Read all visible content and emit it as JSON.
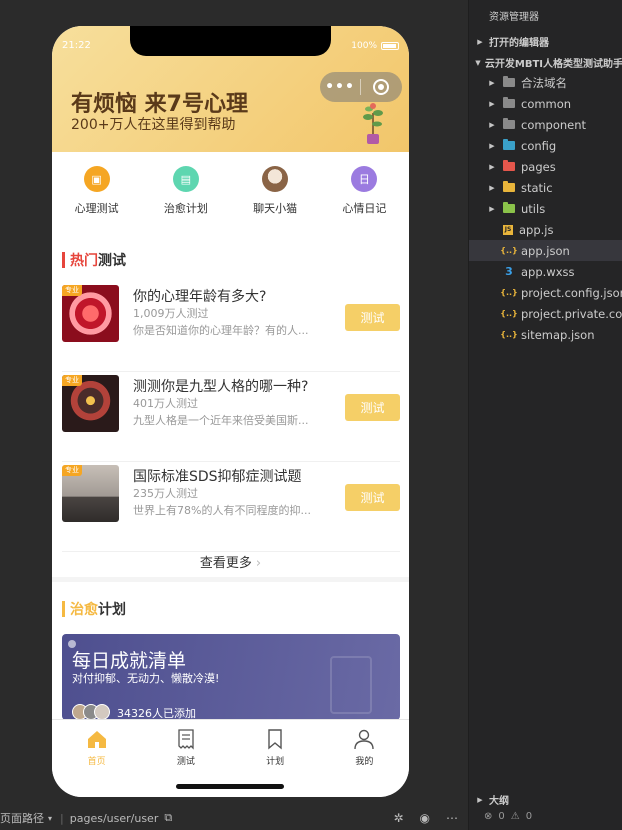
{
  "status": {
    "time": "21:22",
    "battery": "100%"
  },
  "capsule": {
    "more_icon": "ellipsis-icon",
    "close_icon": "record-icon"
  },
  "hero": {
    "title": "有烦恼 来7号心理",
    "subtitle": "200+万人在这里得到帮助"
  },
  "categories": [
    {
      "label": "心理测试",
      "icon": "test-icon",
      "color": "#f5a623"
    },
    {
      "label": "治愈计划",
      "icon": "heal-icon",
      "color": "#5ed6b0"
    },
    {
      "label": "聊天小猫",
      "icon": "cat-icon",
      "color": "#b08a6a"
    },
    {
      "label": "心情日记",
      "icon": "diary-icon",
      "color": "#9b7be0"
    }
  ],
  "hot": {
    "hl": "热门",
    "rest": "测试",
    "color": "#e6453c"
  },
  "tests": [
    {
      "tag": "专业",
      "title": "你的心理年龄有多大?",
      "count": "1,009万人测过",
      "desc": "你是否知道你的心理年龄？有的人...",
      "button": "测试"
    },
    {
      "tag": "专业",
      "title": "测测你是九型人格的哪一种?",
      "count": "401万人测过",
      "desc": "九型人格是一个近年来倍受美国斯...",
      "button": "测试"
    },
    {
      "tag": "专业",
      "title": "国际标准SDS抑郁症测试题",
      "count": "235万人测过",
      "desc": "世界上有78%的人有不同程度的抑...",
      "button": "测试"
    }
  ],
  "more": "查看更多",
  "plan": {
    "hl": "治愈",
    "rest": "计划",
    "color": "#f5b942"
  },
  "promo": {
    "title": "每日成就清单",
    "subtitle": "对付抑郁、无动力、懒散冷漠!",
    "count": "34326人已添加"
  },
  "tabs": [
    {
      "label": "首页",
      "icon": "home-icon",
      "active": true
    },
    {
      "label": "测试",
      "icon": "receipt-icon",
      "active": false
    },
    {
      "label": "计划",
      "icon": "bookmark-icon",
      "active": false
    },
    {
      "label": "我的",
      "icon": "user-icon",
      "active": false
    }
  ],
  "explorer": {
    "title": "资源管理器",
    "open_editors": "打开的编辑器",
    "project": "云开发MBTI人格类型测试助手",
    "items": [
      {
        "name": "合法域名",
        "kind": "folder",
        "color": "#8a8a8a"
      },
      {
        "name": "common",
        "kind": "folder",
        "color": "#8a8a8a"
      },
      {
        "name": "component",
        "kind": "folder",
        "color": "#8a8a8a"
      },
      {
        "name": "config",
        "kind": "folder",
        "color": "#3aa0c8"
      },
      {
        "name": "pages",
        "kind": "folder",
        "color": "#e5574c"
      },
      {
        "name": "static",
        "kind": "folder",
        "color": "#e9b53b"
      },
      {
        "name": "utils",
        "kind": "folder",
        "color": "#8bc34a"
      },
      {
        "name": "app.js",
        "kind": "js"
      },
      {
        "name": "app.json",
        "kind": "json",
        "selected": true
      },
      {
        "name": "app.wxss",
        "kind": "wxss"
      },
      {
        "name": "project.config.json",
        "kind": "json"
      },
      {
        "name": "project.private.config.json",
        "kind": "json"
      },
      {
        "name": "sitemap.json",
        "kind": "json"
      }
    ],
    "outline": "大纲",
    "errors": "0",
    "warnings": "0"
  },
  "statusbar": {
    "path_label": "页面路径",
    "path": "pages/user/user"
  }
}
